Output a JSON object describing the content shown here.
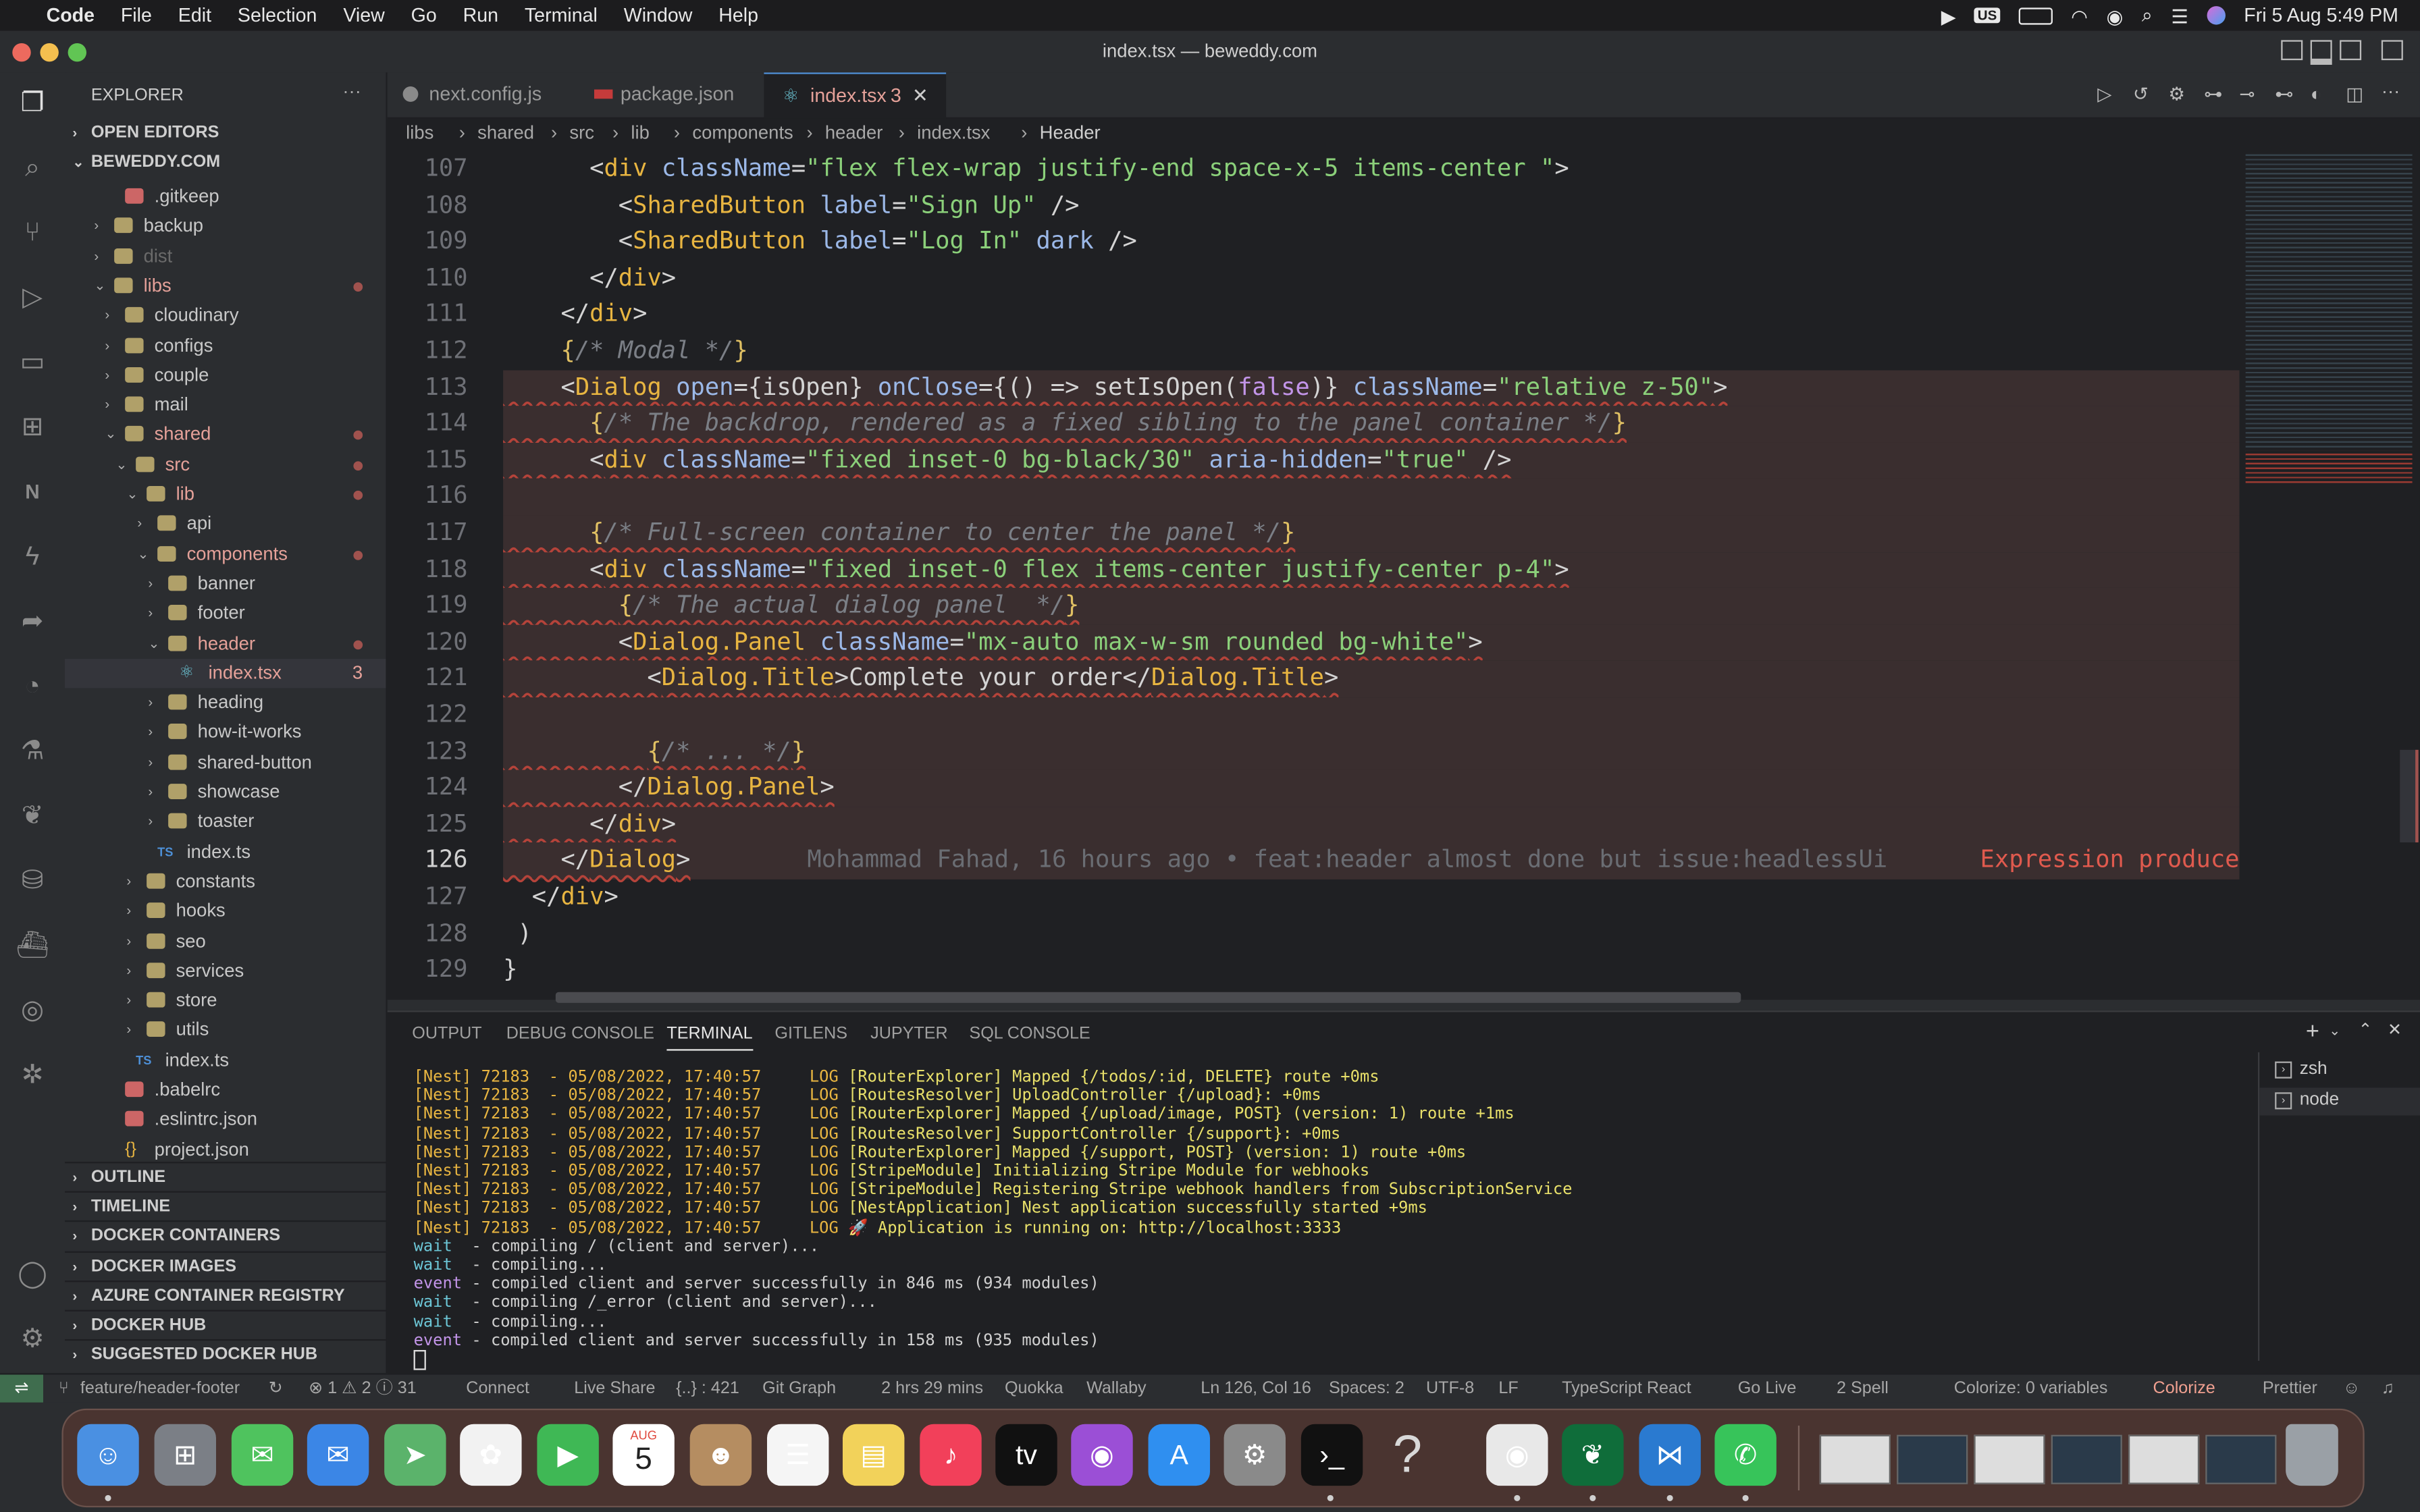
{
  "menubar": {
    "app": "Code",
    "items": [
      "File",
      "Edit",
      "Selection",
      "View",
      "Go",
      "Run",
      "Terminal",
      "Window",
      "Help"
    ],
    "input_source": "US",
    "clock": "Fri 5 Aug  5:49 PM"
  },
  "window": {
    "title": "index.tsx — beweddy.com"
  },
  "sidebar": {
    "title": "EXPLORER",
    "open_editors": "OPEN EDITORS",
    "root": "BEWEDDY.COM",
    "tree": [
      {
        "label": "gitkeep",
        "text": ".gitkeep",
        "kind": "file",
        "dim": false
      },
      {
        "label": "backup",
        "text": "backup",
        "kind": "folder"
      },
      {
        "label": "dist",
        "text": "dist",
        "kind": "folder",
        "dim": true
      },
      {
        "label": "libs",
        "text": "libs",
        "kind": "folder-open",
        "mod": true
      },
      {
        "label": "cloudinary",
        "text": "cloudinary",
        "kind": "folder"
      },
      {
        "label": "configs",
        "text": "configs",
        "kind": "folder"
      },
      {
        "label": "couple",
        "text": "couple",
        "kind": "folder"
      },
      {
        "label": "mail",
        "text": "mail",
        "kind": "folder"
      },
      {
        "label": "shared",
        "text": "shared",
        "kind": "folder-open",
        "mod": true
      },
      {
        "label": "src",
        "text": "src",
        "kind": "folder-open",
        "mod": true
      },
      {
        "label": "lib",
        "text": "lib",
        "kind": "folder-open",
        "mod": true
      },
      {
        "label": "api",
        "text": "api",
        "kind": "folder"
      },
      {
        "label": "components",
        "text": "components",
        "kind": "folder-open",
        "mod": true
      },
      {
        "label": "banner",
        "text": "banner",
        "kind": "folder"
      },
      {
        "label": "footer",
        "text": "footer",
        "kind": "folder"
      },
      {
        "label": "header",
        "text": "header",
        "kind": "folder-open",
        "mod": true
      },
      {
        "label": "index-tsx",
        "text": "index.tsx",
        "kind": "tsx",
        "badge": "3"
      },
      {
        "label": "heading",
        "text": "heading",
        "kind": "folder"
      },
      {
        "label": "how-it-works",
        "text": "how-it-works",
        "kind": "folder"
      },
      {
        "label": "shared-button",
        "text": "shared-button",
        "kind": "folder"
      },
      {
        "label": "showcase",
        "text": "showcase",
        "kind": "folder"
      },
      {
        "label": "toaster",
        "text": "toaster",
        "kind": "folder"
      },
      {
        "label": "index-ts-1",
        "text": "index.ts",
        "kind": "ts"
      },
      {
        "label": "constants",
        "text": "constants",
        "kind": "folder"
      },
      {
        "label": "hooks",
        "text": "hooks",
        "kind": "folder"
      },
      {
        "label": "seo",
        "text": "seo",
        "kind": "folder"
      },
      {
        "label": "services",
        "text": "services",
        "kind": "folder"
      },
      {
        "label": "store",
        "text": "store",
        "kind": "folder"
      },
      {
        "label": "utils",
        "text": "utils",
        "kind": "folder"
      },
      {
        "label": "index-ts-2",
        "text": "index.ts",
        "kind": "ts"
      },
      {
        "label": "babelrc",
        "text": ".babelrc",
        "kind": "file"
      },
      {
        "label": "eslintrc",
        "text": ".eslintrc.json",
        "kind": "file"
      },
      {
        "label": "project-json",
        "text": "project.json",
        "kind": "json"
      }
    ],
    "sections": [
      "OUTLINE",
      "TIMELINE",
      "DOCKER CONTAINERS",
      "DOCKER IMAGES",
      "AZURE CONTAINER REGISTRY",
      "DOCKER HUB",
      "SUGGESTED DOCKER HUB IMAGES"
    ]
  },
  "tabs": [
    {
      "label": "next.config.js"
    },
    {
      "label": "package.json"
    },
    {
      "label": "index.tsx",
      "badge": "3",
      "active": true
    }
  ],
  "breadcrumb": [
    "libs",
    "shared",
    "src",
    "lib",
    "components",
    "header",
    "index.tsx",
    "Header"
  ],
  "editor": {
    "lines": [
      {
        "n": "107",
        "text": "      <div className=\"flex flex-wrap justify-end space-x-5 items-center \">"
      },
      {
        "n": "108",
        "text": "        <SharedButton label=\"Sign Up\" />"
      },
      {
        "n": "109",
        "text": "        <SharedButton label=\"Log In\" dark />"
      },
      {
        "n": "110",
        "text": "      </div>"
      },
      {
        "n": "111",
        "text": "    </div>"
      },
      {
        "n": "112",
        "text": "    {/* Modal */}"
      },
      {
        "n": "113",
        "text": "    <Dialog open={isOpen} onClose={() => setIsOpen(false)} className=\"relative z-50\">"
      },
      {
        "n": "114",
        "text": "      {/* The backdrop, rendered as a fixed sibling to the panel container */}"
      },
      {
        "n": "115",
        "text": "      <div className=\"fixed inset-0 bg-black/30\" aria-hidden=\"true\" />"
      },
      {
        "n": "116",
        "text": ""
      },
      {
        "n": "117",
        "text": "      {/* Full-screen container to center the panel */}"
      },
      {
        "n": "118",
        "text": "      <div className=\"fixed inset-0 flex items-center justify-center p-4\">"
      },
      {
        "n": "119",
        "text": "        {/* The actual dialog panel  */}"
      },
      {
        "n": "120",
        "text": "        <Dialog.Panel className=\"mx-auto max-w-sm rounded bg-white\">"
      },
      {
        "n": "121",
        "text": "          <Dialog.Title>Complete your order</Dialog.Title>"
      },
      {
        "n": "122",
        "text": ""
      },
      {
        "n": "123",
        "text": "          {/* ... */}"
      },
      {
        "n": "124",
        "text": "        </Dialog.Panel>"
      },
      {
        "n": "125",
        "text": "      </div>"
      },
      {
        "n": "126",
        "text": "    </Dialog>"
      },
      {
        "n": "127",
        "text": "  </div>"
      },
      {
        "n": "128",
        "text": " )"
      },
      {
        "n": "129",
        "text": "}"
      }
    ],
    "blame": "Mohammad Fahad, 16 hours ago • feat:header almost done but issue:headlessUi",
    "error_hint": "Expression produce"
  },
  "panel": {
    "tabs": [
      "OUTPUT",
      "DEBUG CONSOLE",
      "TERMINAL",
      "GITLENS",
      "JUPYTER",
      "SQL CONSOLE"
    ],
    "active_tab": "TERMINAL",
    "terminals": [
      "zsh",
      "node"
    ],
    "log": [
      "[Nest] 72183  - 05/08/2022, 17:40:57     LOG [RouterExplorer] Mapped {/todos/:id, DELETE} route +0ms",
      "[Nest] 72183  - 05/08/2022, 17:40:57     LOG [RoutesResolver] UploadController {/upload}: +0ms",
      "[Nest] 72183  - 05/08/2022, 17:40:57     LOG [RouterExplorer] Mapped {/upload/image, POST} (version: 1) route +1ms",
      "[Nest] 72183  - 05/08/2022, 17:40:57     LOG [RoutesResolver] SupportController {/support}: +0ms",
      "[Nest] 72183  - 05/08/2022, 17:40:57     LOG [RouterExplorer] Mapped {/support, POST} (version: 1) route +0ms",
      "[Nest] 72183  - 05/08/2022, 17:40:57     LOG [StripeModule] Initializing Stripe Module for webhooks",
      "[Nest] 72183  - 05/08/2022, 17:40:57     LOG [StripeModule] Registering Stripe webhook handlers from SubscriptionService",
      "[Nest] 72183  - 05/08/2022, 17:40:57     LOG [NestApplication] Nest application successfully started +9ms",
      "[Nest] 72183  - 05/08/2022, 17:40:57     LOG 🚀 Application is running on: http://localhost:3333"
    ],
    "next_log": [
      {
        "kw": "wait",
        "text": "  - compiling / (client and server)..."
      },
      {
        "kw": "wait",
        "text": "  - compiling..."
      },
      {
        "kw": "event",
        "text": " - compiled client and server successfully in 846 ms (934 modules)"
      },
      {
        "kw": "wait",
        "text": "  - compiling /_error (client and server)..."
      },
      {
        "kw": "wait",
        "text": "  - compiling..."
      },
      {
        "kw": "event",
        "text": " - compiled client and server successfully in 158 ms (935 modules)"
      }
    ]
  },
  "status": {
    "branch": "feature/header-footer",
    "problems": "⊗ 1 ⚠ 2 ⓘ 31",
    "connect": "Connect",
    "live_share": "Live Share",
    "braces": "{..} : 421",
    "git_graph": "Git Graph",
    "time": "2 hrs 29 mins",
    "quokka": "Quokka",
    "wallaby": "Wallaby",
    "position": "Ln 126, Col 16",
    "spaces": "Spaces: 2",
    "encoding": "UTF-8",
    "eol": "LF",
    "language": "TypeScript React",
    "go_live": "Go Live",
    "spell": "2 Spell",
    "colorize_vars": "Colorize: 0 variables",
    "colorize": "Colorize",
    "prettier": "Prettier"
  },
  "dock": {
    "calendar_month": "AUG",
    "calendar_day": "5",
    "tv_label": "tv",
    "help_glyph": "?"
  }
}
